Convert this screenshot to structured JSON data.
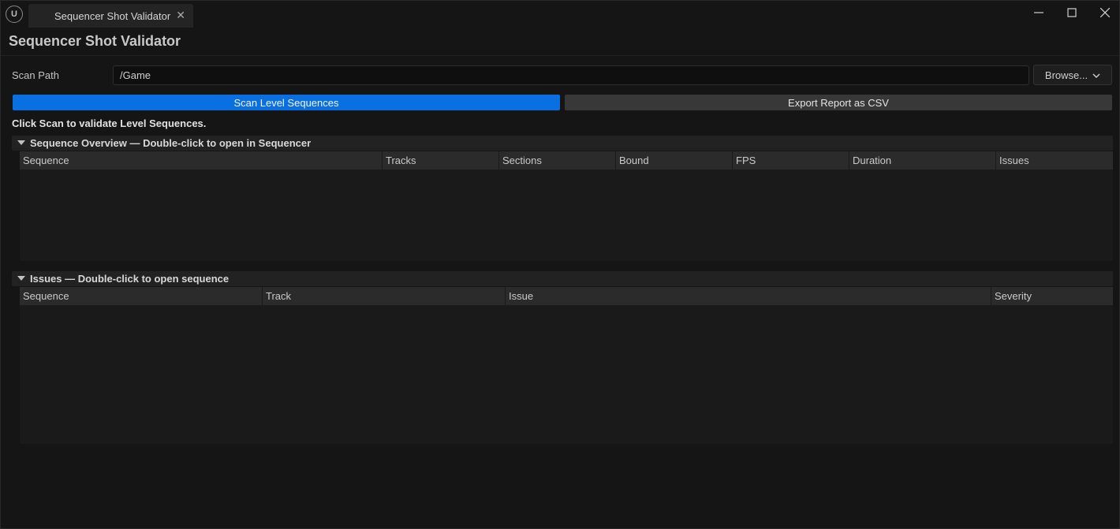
{
  "window": {
    "tab_title": "Sequencer Shot Validator",
    "logo_text": "U",
    "controls": [
      "minimize-icon",
      "maximize-icon",
      "close-icon"
    ]
  },
  "page": {
    "title": "Sequencer Shot Validator"
  },
  "scan": {
    "label": "Scan Path",
    "value": "/Game",
    "browse_label": "Browse..."
  },
  "actions": {
    "scan_label": "Scan Level Sequences",
    "export_label": "Export Report as CSV"
  },
  "status": "Click Scan to validate Level Sequences.",
  "overview": {
    "header": "Sequence Overview — Double-click to open in Sequencer",
    "columns": [
      "Sequence",
      "Tracks",
      "Sections",
      "Bound",
      "FPS",
      "Duration",
      "Issues"
    ],
    "rows": []
  },
  "issues": {
    "header": "Issues — Double-click to open sequence",
    "columns": [
      "Sequence",
      "Track",
      "Issue",
      "Severity"
    ],
    "rows": []
  },
  "colors": {
    "background": "#151515",
    "accent": "#0a70e2",
    "header_bg": "#2b2b2b"
  }
}
